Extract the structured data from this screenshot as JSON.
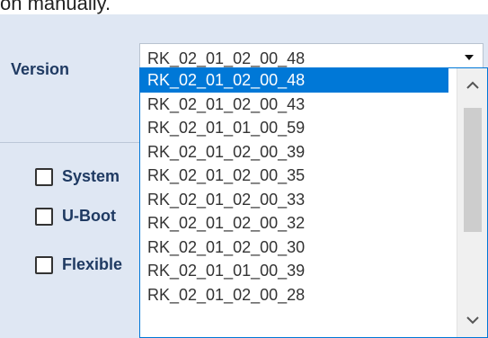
{
  "caption": "on manually.",
  "version": {
    "label": "Version",
    "selected_value": "RK_02_01_02_00_48",
    "options": [
      "RK_02_01_02_00_48",
      "RK_02_01_02_00_43",
      "RK_02_01_01_00_59",
      "RK_02_01_02_00_39",
      "RK_02_01_02_00_35",
      "RK_02_01_02_00_33",
      "RK_02_01_02_00_32",
      "RK_02_01_02_00_30",
      "RK_02_01_01_00_39",
      "RK_02_01_02_00_28"
    ],
    "highlighted_index": 0
  },
  "checkboxes": [
    {
      "label": "System",
      "checked": false
    },
    {
      "label": "U-Boot",
      "checked": false
    },
    {
      "label": "Flexible",
      "checked": false
    }
  ],
  "icons": {
    "combo_arrow": "triangle-down-icon",
    "scroll_up": "chevron-up-icon",
    "scroll_down": "chevron-down-icon"
  },
  "colors": {
    "panel_background": "#dfe7f3",
    "label_text": "#1f3a62",
    "selection": "#0078d7"
  }
}
